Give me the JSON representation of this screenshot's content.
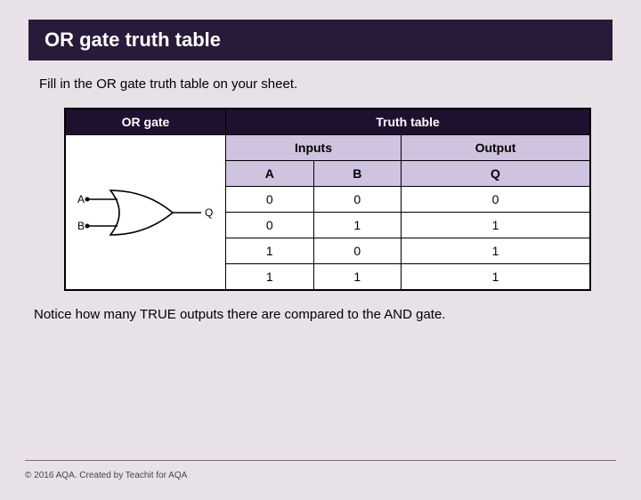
{
  "title": "OR gate truth table",
  "intro": "Fill in the OR gate truth table on your sheet.",
  "table": {
    "gate_header": "OR gate",
    "truth_header": "Truth table",
    "inputs_header": "Inputs",
    "output_header": "Output",
    "cols": {
      "A": "A",
      "B": "B",
      "Q": "Q"
    },
    "rows": [
      {
        "A": "0",
        "B": "0",
        "Q": "0"
      },
      {
        "A": "0",
        "B": "1",
        "Q": "1"
      },
      {
        "A": "1",
        "B": "0",
        "Q": "1"
      },
      {
        "A": "1",
        "B": "1",
        "Q": "1"
      }
    ],
    "gate_labels": {
      "A": "A",
      "B": "B",
      "Q": "Q"
    }
  },
  "outro": "Notice how many TRUE outputs there are compared to the  AND gate.",
  "footer": "© 2016 AQA. Created by Teachit for AQA",
  "chart_data": {
    "type": "table",
    "title": "OR gate truth table",
    "columns": [
      "A",
      "B",
      "Q"
    ],
    "rows": [
      [
        0,
        0,
        0
      ],
      [
        0,
        1,
        1
      ],
      [
        1,
        0,
        1
      ],
      [
        1,
        1,
        1
      ]
    ]
  }
}
